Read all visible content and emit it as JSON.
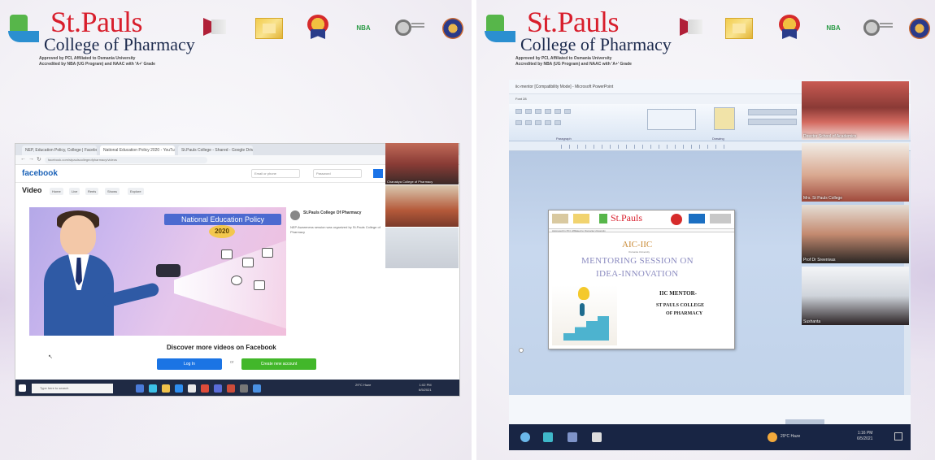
{
  "header": {
    "brand_name": "St.Pauls",
    "brand_sub": "College of Pharmacy",
    "accreditation_line1": "Approved by PCI, Affiliated to Osmania University",
    "accreditation_line2": "Accredited by NBA (UG Program) and NAAC with 'A+' Grade",
    "nbr_badge": "NBA"
  },
  "left_screen": {
    "tabs": [
      "NEP, Education Policy, College | Facebook",
      "National Education Policy 2020 - YouTube",
      "St.Pauls College - Shared - Google Drive"
    ],
    "url": "facebook.com/stpaulscollegeofpharmacy/videos",
    "facebook_logo": "facebook",
    "email_placeholder": "Email or phone",
    "password_placeholder": "Password",
    "video_heading": "Video",
    "chips": [
      "Home",
      "Live",
      "Reels",
      "Shows",
      "Explore"
    ],
    "video_banner": "National Education Policy",
    "video_year": "2020",
    "post_page": "St.Pauls College Of Pharmacy",
    "post_caption": "NEP Awareness session was organized by St.Pauls College of Pharmacy",
    "discover_text": "Discover more videos on Facebook",
    "login_label": "Log In",
    "or_label": "or",
    "create_label": "Create new account",
    "taskbar_search": "Type here to search",
    "tray_time": "1:02 PM",
    "tray_date": "6/5/2021",
    "tray_weather": "29°C Haze",
    "tiles": [
      "Chanakya College of Pharmacy",
      "",
      ""
    ]
  },
  "right_screen": {
    "window_title": "iic-mentor [Compatibility Mode] - Microsoft PowerPoint",
    "cell_ref": "Font 28",
    "ribbon_labels": [
      "Paragraph",
      "Drawing"
    ],
    "slide": {
      "logo": "St.Pauls",
      "aic": "AIC-IIC",
      "aic_sub": "Osmania University",
      "mentoring_line1": "MENTORING SESSION ON",
      "mentoring_line2": "IDEA-INNOVATION",
      "iic_mentor": "IIC MENTOR-",
      "college_line1": "ST PAULS COLLEGE",
      "college_line2": "OF PHARMACY"
    },
    "tiles": [
      "Director School of Academics",
      "Mrs. St Pauls College",
      "Prof Dr Sreenivas",
      "Sushanta"
    ],
    "tray_weather": "29°C Haze",
    "tray_time": "1:16 PM",
    "tray_date": "6/5/2021"
  },
  "colors": {
    "brand_red": "#d81e2c",
    "brand_navy": "#1d2b4e",
    "facebook_blue": "#1b74e4",
    "facebook_green": "#42b72a",
    "taskbar": "#1f2a44"
  }
}
